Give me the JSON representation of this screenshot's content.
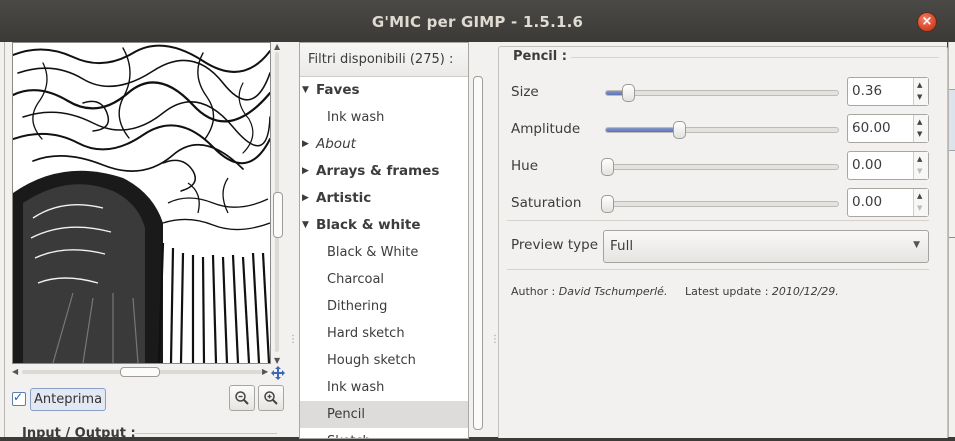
{
  "window": {
    "title": "G'MIC per GIMP - 1.5.1.6"
  },
  "preview": {
    "checkbox_label": "Anteprima",
    "checked": true
  },
  "io": {
    "label": "Input / Output :"
  },
  "filters": {
    "header": "Filtri disponibili (275) :",
    "rows": [
      {
        "type": "category",
        "label": "Faves",
        "expanded": true
      },
      {
        "type": "item",
        "label": "Ink wash"
      },
      {
        "type": "category",
        "label": "About",
        "expanded": false,
        "italic": true
      },
      {
        "type": "category",
        "label": "Arrays & frames",
        "expanded": false
      },
      {
        "type": "category",
        "label": "Artistic",
        "expanded": false
      },
      {
        "type": "category",
        "label": "Black & white",
        "expanded": true
      },
      {
        "type": "item",
        "label": "Black & White"
      },
      {
        "type": "item",
        "label": "Charcoal"
      },
      {
        "type": "item",
        "label": "Dithering"
      },
      {
        "type": "item",
        "label": "Hard sketch"
      },
      {
        "type": "item",
        "label": "Hough sketch"
      },
      {
        "type": "item",
        "label": "Ink wash"
      },
      {
        "type": "item",
        "label": "Pencil",
        "selected": true
      },
      {
        "type": "item",
        "label": "Sketch"
      }
    ]
  },
  "params": {
    "title": "Pencil :",
    "sliders": [
      {
        "label": "Size",
        "value": "0.36",
        "fraction": 0.09
      },
      {
        "label": "Amplitude",
        "value": "60.00",
        "fraction": 0.31
      },
      {
        "label": "Hue",
        "value": "0.00",
        "fraction": 0.0
      },
      {
        "label": "Saturation",
        "value": "0.00",
        "fraction": 0.0
      }
    ],
    "preview_type": {
      "label": "Preview type",
      "value": "Full"
    },
    "author_label": "Author :",
    "author": "David Tschumperlé.",
    "update_label": "Latest update :",
    "update": "2010/12/29."
  },
  "colors": {
    "accent": "#5e72b4",
    "title_bar": "#3c3b37",
    "close": "#d8482a"
  },
  "icons": {
    "close": "close-icon",
    "zoom_out": "zoom-out-icon",
    "zoom_in": "zoom-in-icon",
    "move": "move-icon",
    "expanded": "triangle-down-icon",
    "collapsed": "triangle-right-icon"
  }
}
